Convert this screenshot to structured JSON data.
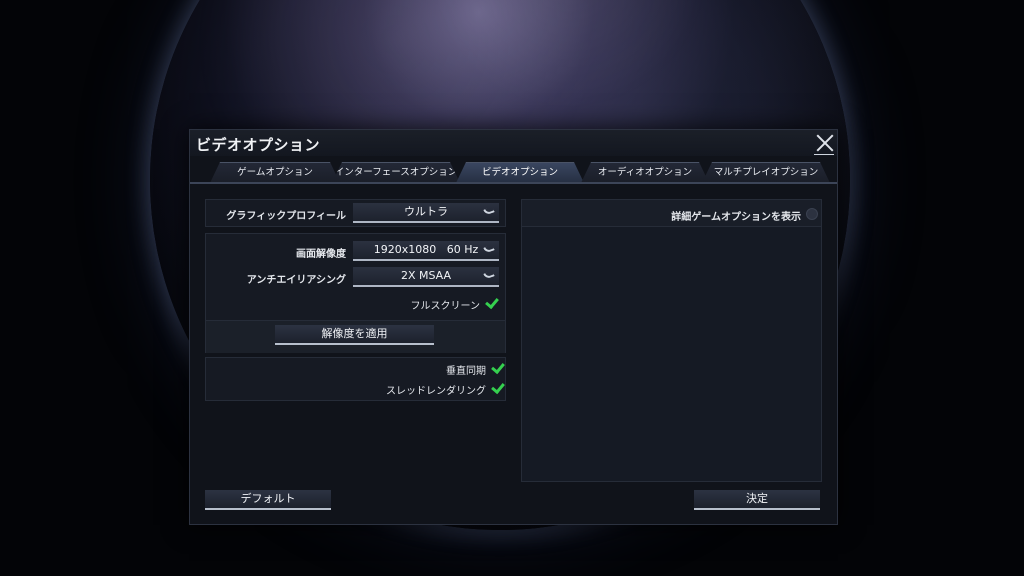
{
  "dialog": {
    "title": "ビデオオプション"
  },
  "tabs": [
    {
      "label": "ゲームオプション",
      "active": false
    },
    {
      "label": "インターフェースオプション",
      "active": false
    },
    {
      "label": "ビデオオプション",
      "active": true
    },
    {
      "label": "オーディオオプション",
      "active": false
    },
    {
      "label": "マルチプレイオプション",
      "active": false
    }
  ],
  "graphics_profile": {
    "label": "グラフィックプロフィール",
    "value": "ウルトラ"
  },
  "resolution": {
    "label": "画面解像度",
    "value": "1920x1080   60 Hz"
  },
  "antialiasing": {
    "label": "アンチエイリアシング",
    "value": "2X MSAA"
  },
  "fullscreen": {
    "label": "フルスクリーン",
    "checked": true
  },
  "apply_resolution_label": "解像度を適用",
  "vsync": {
    "label": "垂直同期",
    "checked": true
  },
  "threaded_rendering": {
    "label": "スレッドレンダリング",
    "checked": true
  },
  "advanced_options": {
    "label": "詳細ゲームオプションを表示",
    "checked": false
  },
  "buttons": {
    "default_label": "デフォルト",
    "confirm_label": "決定"
  },
  "colors": {
    "check": "#35d04f",
    "active_tab": "#3a4660"
  }
}
